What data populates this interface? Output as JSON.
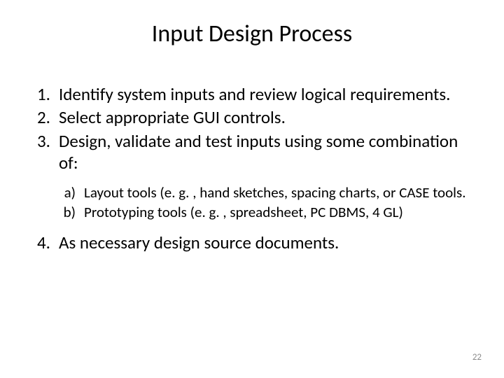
{
  "title": "Input Design Process",
  "items": [
    {
      "num": "1.",
      "text": "Identify system inputs and review logical requirements."
    },
    {
      "num": "2.",
      "text": "Select appropriate GUI controls."
    },
    {
      "num": "3.",
      "text": "Design, validate and test inputs using some combination of:"
    }
  ],
  "subitems": [
    {
      "num": "a)",
      "text": "Layout tools (e. g. , hand sketches, spacing charts, or CASE tools."
    },
    {
      "num": "b)",
      "text": "Prototyping tools (e. g. , spreadsheet, PC DBMS, 4 GL)"
    }
  ],
  "item4": {
    "num": "4.",
    "text": "As necessary design source documents."
  },
  "pageNumber": "22"
}
